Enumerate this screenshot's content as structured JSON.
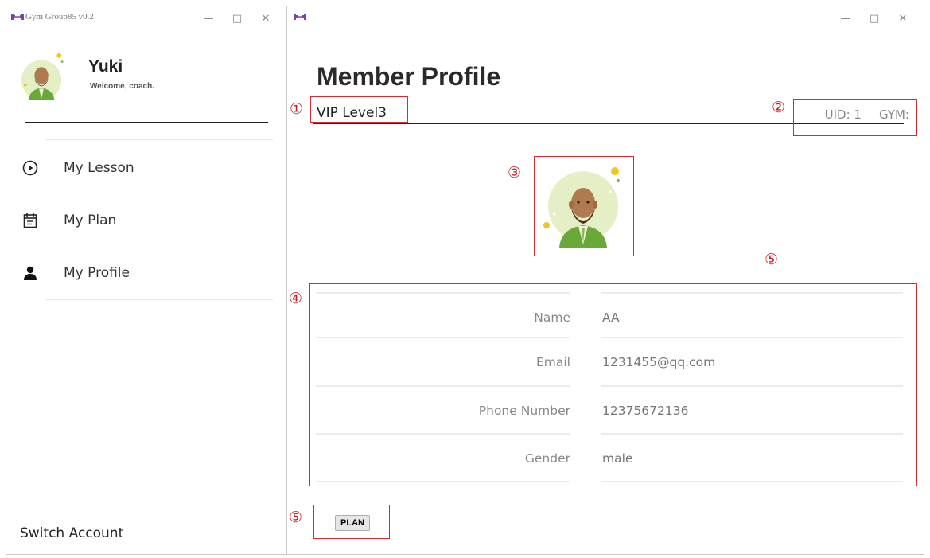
{
  "left_window": {
    "title": "Gym Group85 v0.2",
    "controls": [
      "—",
      "□",
      "✕"
    ],
    "user": {
      "name": "Yuki",
      "welcome": "Welcome, coach."
    },
    "menu": [
      {
        "label": "My Lesson",
        "icon": "play-circle-icon"
      },
      {
        "label": "My Plan",
        "icon": "calendar-icon"
      },
      {
        "label": "My Profile",
        "icon": "person-icon"
      }
    ],
    "switch_account": "Switch Account"
  },
  "right_window": {
    "controls": [
      "—",
      "□",
      "✕"
    ],
    "page_title": "Member Profile",
    "vip_level": "VIP Level3",
    "uid": "UID: 1",
    "gym": "GYM:",
    "fields": [
      {
        "label": "Name",
        "value": "AA"
      },
      {
        "label": "Email",
        "value": "1231455@qq.com"
      },
      {
        "label": "Phone Number",
        "value": "12375672136"
      },
      {
        "label": "Gender",
        "value": "male"
      }
    ],
    "plan_button": "PLAN"
  },
  "annotations": {
    "a1": "①",
    "a2": "②",
    "a3": "③",
    "a4": "④",
    "a5": "⑤",
    "a5b": "⑤"
  },
  "colors": {
    "annotation": "#e0262d",
    "app_icon": "#7b3fb0",
    "avatar_bg": "#e5efc6",
    "avatar_shirt": "#6aa83a"
  }
}
